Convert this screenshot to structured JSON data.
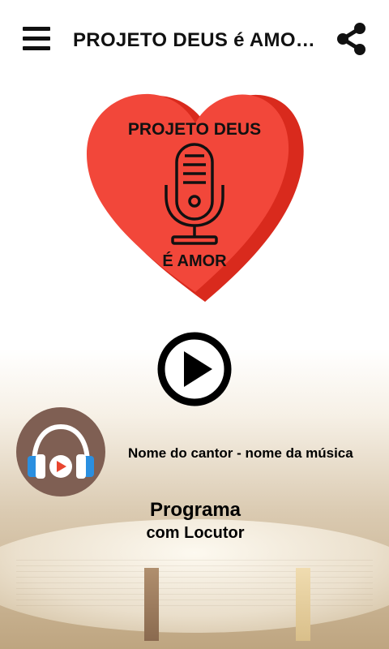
{
  "header": {
    "title": "PROJETO DEUS é AMO…",
    "menu_icon": "hamburger-menu-icon",
    "share_icon": "share-icon"
  },
  "logo": {
    "line1": "PROJETO DEUS",
    "line2": "É AMOR",
    "icon": "microphone-icon",
    "heart_color": "#f2473a"
  },
  "player": {
    "play_icon": "play-icon",
    "now_playing": "Nome do cantor - nome da música",
    "avatar_icon": "headphones-play-icon"
  },
  "program": {
    "title": "Programa",
    "host": "com Locutor"
  }
}
